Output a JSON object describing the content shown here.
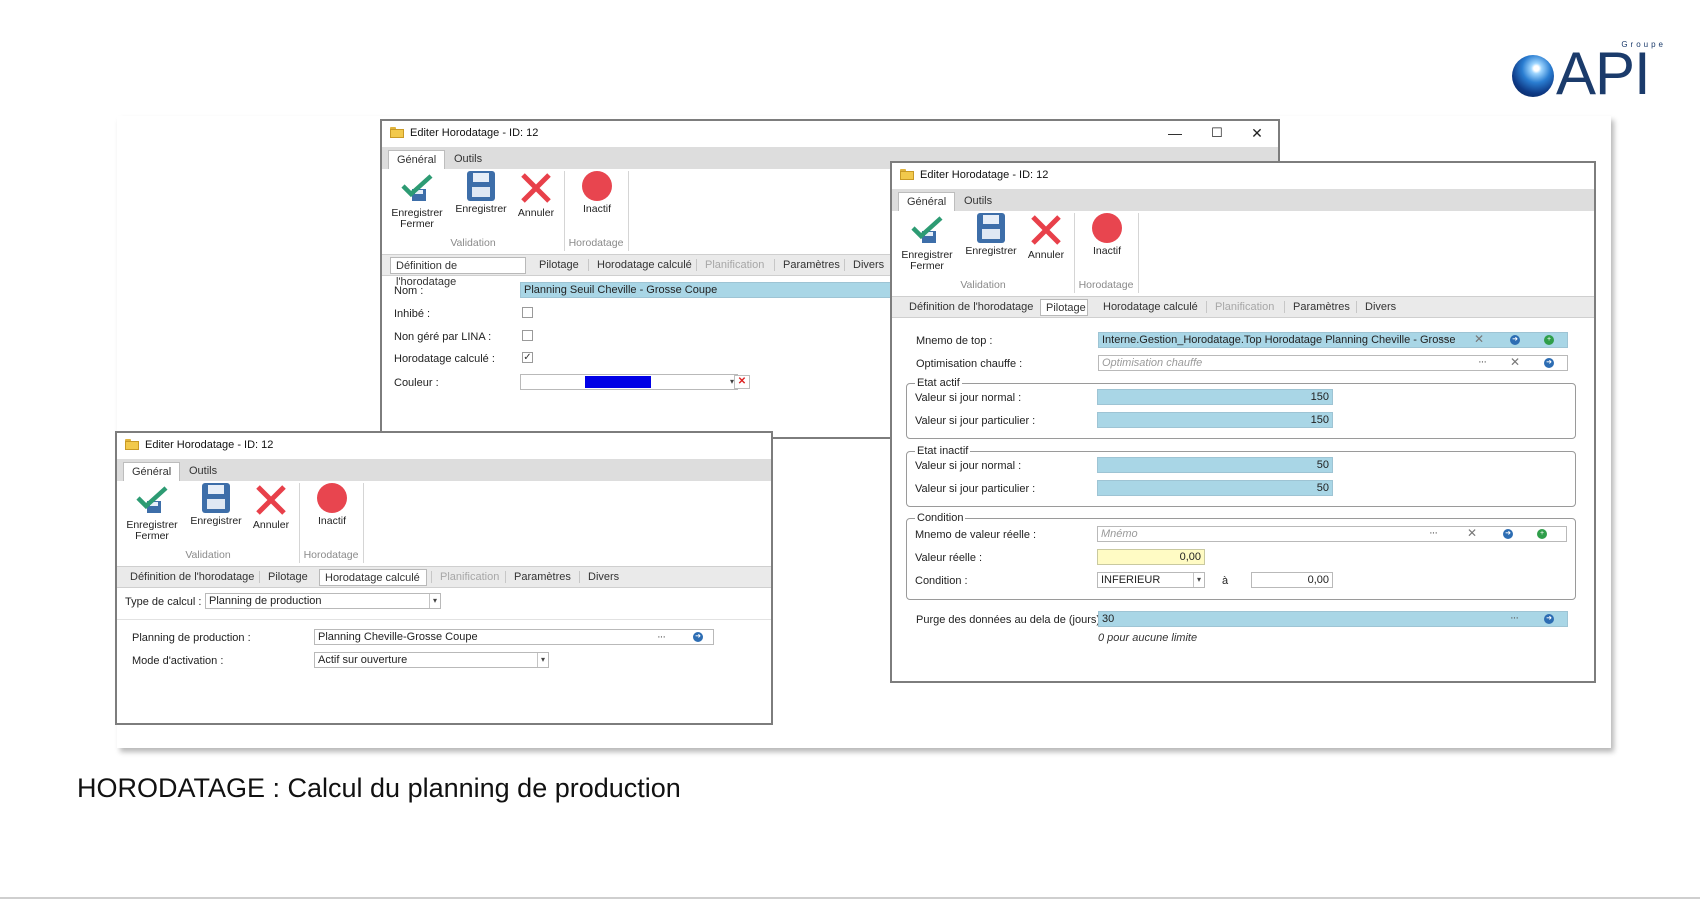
{
  "logo": {
    "groupe": "Groupe",
    "brand": "API"
  },
  "caption": "HORODATAGE : Calcul du planning de production",
  "window_title": "Editer Horodatage - ID: 12",
  "window_controls": {
    "minimize": "—",
    "maximize": "☐",
    "close": "✕"
  },
  "ribbon": {
    "tabs": [
      "Général",
      "Outils"
    ],
    "save_close": "Enregistrer\nFermer",
    "save": "Enregistrer",
    "cancel": "Annuler",
    "inactive": "Inactif",
    "group_validation": "Validation",
    "group_horodatage": "Horodatage"
  },
  "subtabs": [
    "Définition de l'horodatage",
    "Pilotage",
    "Horodatage calculé",
    "Planification",
    "Paramètres",
    "Divers"
  ],
  "win1": {
    "nom_label": "Nom :",
    "nom_value": "Planning Seuil Cheville - Grosse Coupe",
    "inhibe_label": "Inhibé :",
    "non_gere_label": "Non géré par LINA :",
    "horo_calc_label": "Horodatage calculé :",
    "horo_calc_check": "✓",
    "couleur_label": "Couleur :",
    "couleur_value": "#0000e6"
  },
  "win2": {
    "type_calcul_label": "Type de calcul :",
    "type_calcul_value": "Planning de production",
    "planning_label": "Planning de production :",
    "planning_value": "Planning Cheville-Grosse Coupe",
    "mode_label": "Mode d'activation :",
    "mode_value": "Actif sur ouverture"
  },
  "win3": {
    "mnemo_top_label": "Mnemo de top :",
    "mnemo_top_value": "Interne.Gestion_Horodatage.Top Horodatage Planning Cheville - Grosse",
    "optim_label": "Optimisation chauffe :",
    "optim_placeholder": "Optimisation chauffe",
    "etat_actif": "Etat actif",
    "etat_inactif": "Etat inactif",
    "jour_normal_label": "Valeur si jour normal :",
    "jour_particulier_label": "Valeur si jour particulier :",
    "actif_normal": "150",
    "actif_particulier": "150",
    "inactif_normal": "50",
    "inactif_particulier": "50",
    "condition_group": "Condition",
    "mnemo_reelle_label": "Mnemo de valeur réelle :",
    "mnemo_reelle_placeholder": "Mnémo",
    "valeur_reelle_label": "Valeur réelle :",
    "valeur_reelle_value": "0,00",
    "condition_label": "Condition :",
    "condition_value": "INFERIEUR",
    "a_label": "à",
    "condition_threshold": "0,00",
    "purge_label": "Purge des données au dela de (jours) :",
    "purge_value": "30",
    "purge_hint": "0 pour aucune limite"
  },
  "glyphs": {
    "dots": "···",
    "x": "✕",
    "arrow": "➜",
    "plus": "+",
    "dd": "▾",
    "redx": "✕"
  }
}
